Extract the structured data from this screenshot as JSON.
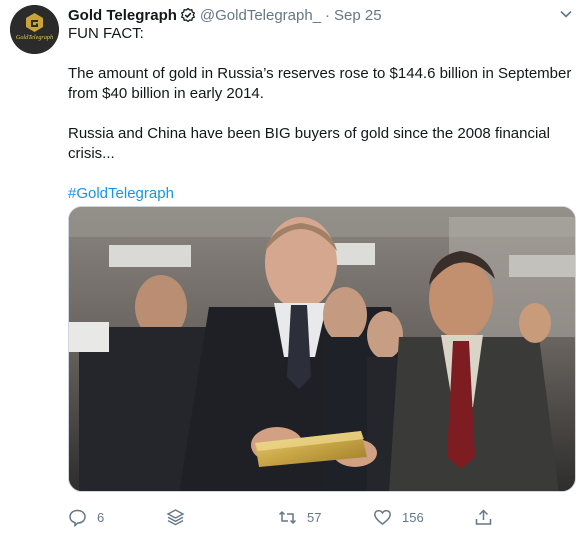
{
  "tweet": {
    "author_name": "Gold Telegraph",
    "handle": "@GoldTelegraph_",
    "separator": "·",
    "date": "Sep 25",
    "avatar_text": "GoldTelegraph",
    "lines": [
      "FUN FACT:",
      "The amount of gold in Russia’s reserves rose to $144.6 billion in September from $40 billion in early 2014.",
      "Russia and China have been BIG buyers of gold since the 2008 financial crisis..."
    ],
    "hashtag": "#GoldTelegraph"
  },
  "actions": {
    "replies": "6",
    "retweets": "57",
    "likes": "156"
  },
  "icons": {
    "verified": "verified-badge-icon",
    "caret": "chevron-down-icon",
    "reply": "reply-icon",
    "stack": "stack-icon",
    "retweet": "retweet-icon",
    "like": "heart-icon",
    "share": "share-icon"
  },
  "colors": {
    "text": "#14171a",
    "muted": "#657786",
    "link": "#1b95e0",
    "gold": "#c9a43a"
  }
}
